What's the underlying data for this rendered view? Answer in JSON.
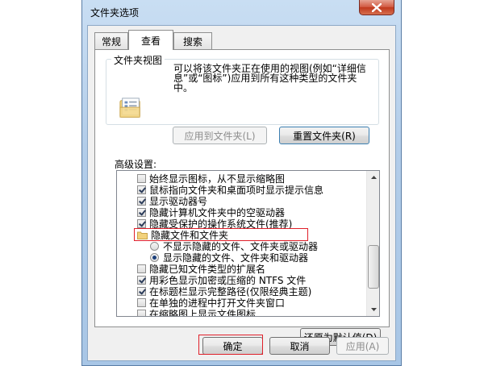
{
  "window": {
    "title": "文件夹选项"
  },
  "tabs": [
    {
      "label": "常规"
    },
    {
      "label": "查看"
    },
    {
      "label": "搜索"
    }
  ],
  "folder_views": {
    "title": "文件夹视图",
    "description": "可以将该文件夹正在使用的视图(例如“详细信息”或“图标”)应用到所有这种类型的文件夹中。",
    "apply_label": "应用到文件夹(L)",
    "reset_label": "重置文件夹(R)"
  },
  "advanced": {
    "label": "高级设置:",
    "items": [
      {
        "type": "checkbox",
        "checked": false,
        "label": "始终显示图标，从不显示缩略图"
      },
      {
        "type": "checkbox",
        "checked": true,
        "label": "鼠标指向文件夹和桌面项时显示提示信息"
      },
      {
        "type": "checkbox",
        "checked": true,
        "label": "显示驱动器号"
      },
      {
        "type": "checkbox",
        "checked": true,
        "label": "隐藏计算机文件夹中的空驱动器"
      },
      {
        "type": "checkbox",
        "checked": true,
        "label": "隐藏受保护的操作系统文件(推荐)"
      },
      {
        "type": "folder",
        "label": "隐藏文件和文件夹"
      },
      {
        "type": "radio",
        "checked": false,
        "label": "不显示隐藏的文件、文件夹或驱动器"
      },
      {
        "type": "radio",
        "checked": true,
        "label": "显示隐藏的文件、文件夹和驱动器"
      },
      {
        "type": "checkbox",
        "checked": false,
        "label": "隐藏已知文件类型的扩展名"
      },
      {
        "type": "checkbox",
        "checked": true,
        "label": "用彩色显示加密或压缩的 NTFS 文件"
      },
      {
        "type": "checkbox",
        "checked": true,
        "label": "在标题栏显示完整路径(仅限经典主题)"
      },
      {
        "type": "checkbox",
        "checked": false,
        "label": "在单独的进程中打开文件夹窗口"
      },
      {
        "type": "checkbox",
        "checked": false,
        "label": "在缩略图上显示文件图标"
      }
    ],
    "restore_label": "还原为默认值(D)"
  },
  "footer": {
    "ok_label": "确定",
    "cancel_label": "取消",
    "apply_label": "应用(A)"
  },
  "colors": {
    "highlight": "#e0202a",
    "accent": "#3c7fb1"
  }
}
